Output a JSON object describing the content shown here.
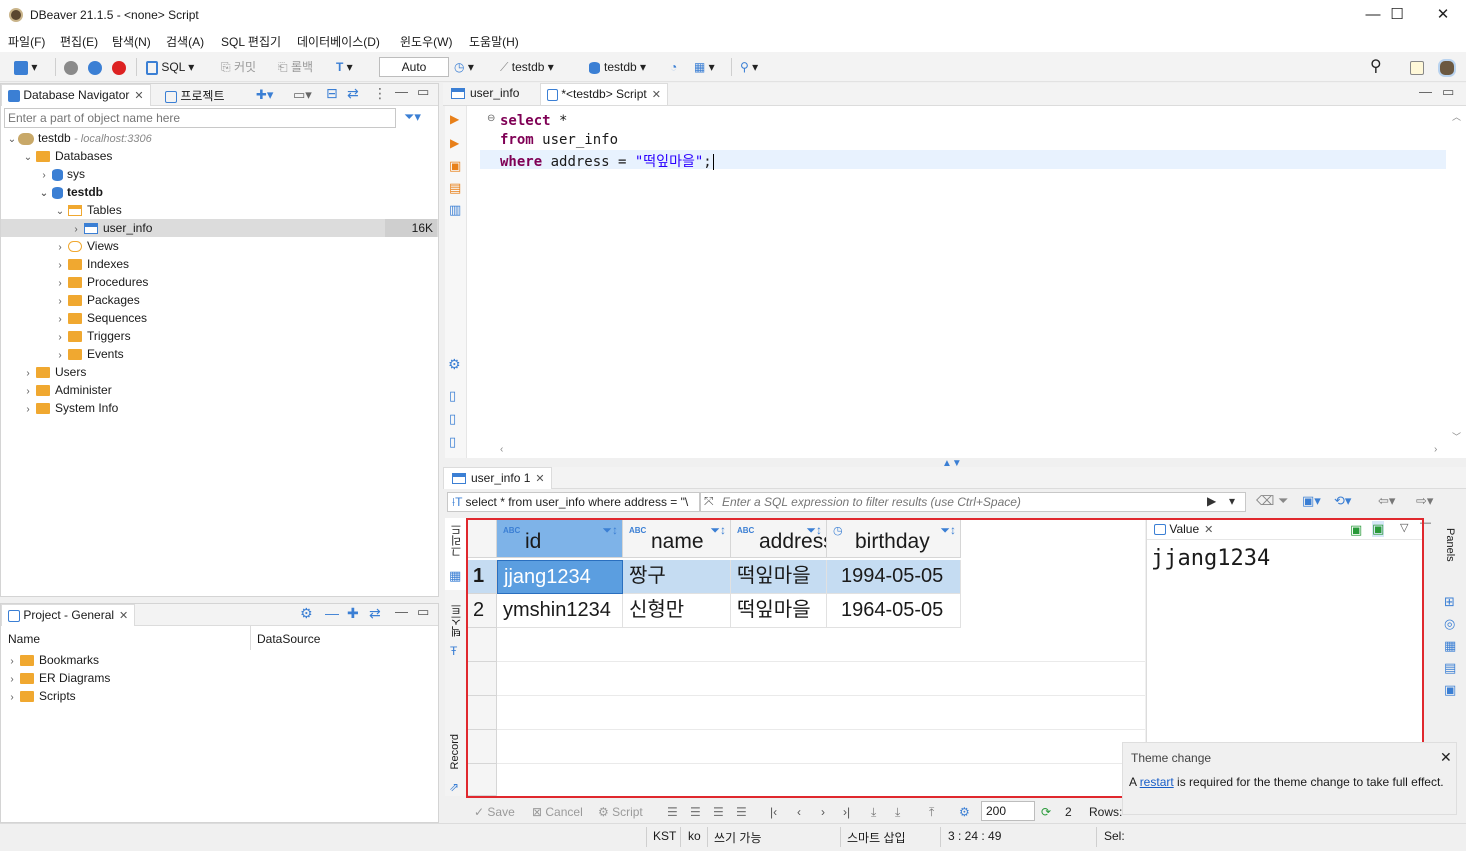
{
  "window": {
    "title": "DBeaver 21.1.5 - <none> Script",
    "minimize": "—",
    "maximize": "☐",
    "close": "✕"
  },
  "menu": [
    "파일(F)",
    "편집(E)",
    "탐색(N)",
    "검색(A)",
    "SQL 편집기",
    "데이터베이스(D)",
    "윈도우(W)",
    "도움말(H)"
  ],
  "toolbar": {
    "sql": "SQL",
    "commit": "커밋",
    "rollback": "롤백",
    "auto": "Auto",
    "datasource": "testdb",
    "schema": "testdb"
  },
  "navigator": {
    "tab_label": "Database Navigator",
    "projects_tab": "프로젝트",
    "filter_placeholder": "Enter a part of object name here",
    "connection": {
      "name": "testdb",
      "host": "- localhost:3306"
    },
    "databases_label": "Databases",
    "sys_label": "sys",
    "testdb_label": "testdb",
    "tables_label": "Tables",
    "user_info": {
      "name": "user_info",
      "size": "16K"
    },
    "folders": [
      "Views",
      "Indexes",
      "Procedures",
      "Packages",
      "Sequences",
      "Triggers",
      "Events"
    ],
    "users": "Users",
    "administer": "Administer",
    "system_info": "System Info"
  },
  "project": {
    "tab_label": "Project - General",
    "col_name": "Name",
    "col_datasource": "DataSource",
    "items": [
      "Bookmarks",
      "ER Diagrams",
      "Scripts"
    ]
  },
  "editor": {
    "tabs": [
      "user_info",
      "*<testdb> Script"
    ],
    "lines": [
      {
        "kw": "select",
        "rest": " *"
      },
      {
        "kw": "from",
        "rest": " user_info"
      },
      {
        "kw": "where",
        "rest": " address = ",
        "str": "\"떡잎마을\"",
        "end": ";"
      }
    ]
  },
  "results": {
    "tab_label": "user_info 1",
    "query_label": "select * from user_info where address = \"\\",
    "filter_placeholder": "Enter a SQL expression to filter results (use Ctrl+Space)",
    "side_tabs": {
      "grid": "그리드",
      "text": "텍스트",
      "record": "Record"
    },
    "columns": [
      "id",
      "name",
      "address",
      "birthday"
    ],
    "rows": [
      [
        "jjang1234",
        "짱구",
        "떡잎마을",
        "1994-05-05"
      ],
      [
        "ymshin1234",
        "신형만",
        "떡잎마을",
        "1964-05-05"
      ]
    ],
    "row_numbers": [
      "1",
      "2"
    ],
    "value_panel": {
      "title": "Value",
      "content": "jjang1234"
    },
    "panels_label": "Panels",
    "bottom": {
      "save": "Save",
      "cancel": "Cancel",
      "script": "Script",
      "fetch_size": "200",
      "row_count": "2",
      "rows_label": "Rows:"
    }
  },
  "notification": {
    "title": "Theme change",
    "prefix": "A ",
    "link": "restart",
    "suffix": " is required for the theme change to take full effect."
  },
  "status": {
    "tz": "KST",
    "locale": "ko",
    "mode": "쓰기 가능",
    "insert": "스마트 삽입",
    "position": "3 : 24 : 49",
    "sel": "Sel:"
  },
  "colors": {
    "accent": "#3b7fd4",
    "selection_row": "#c5dcf2",
    "selected_cell": "#5b9ee0",
    "highlight_box": "#e0282e",
    "keyword": "#7f0055",
    "string": "#2a00ff"
  }
}
